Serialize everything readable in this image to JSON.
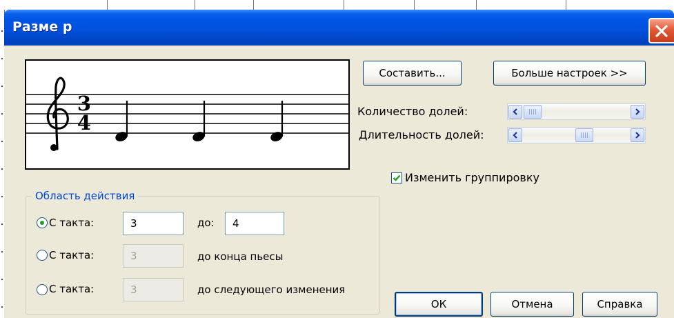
{
  "window": {
    "title": "Разме р"
  },
  "buttons": {
    "compose": "Составить...",
    "more_settings": "Больше настроек >>",
    "ok": "ОК",
    "cancel": "Отмена",
    "help": "Справка"
  },
  "beats": {
    "count_label": "Количество долей:",
    "count_value_fraction": 0.1,
    "duration_label": "Длительность долей:",
    "duration_value_fraction": 0.6
  },
  "regroup": {
    "label": "Изменить группировку",
    "checked": true
  },
  "scope": {
    "legend": "Область действия",
    "options": [
      {
        "label": "С такта:",
        "from": "3",
        "to_label": "до:",
        "to": "4",
        "selected": true,
        "enabled": true
      },
      {
        "label": "С такта:",
        "from": "3",
        "to_label": "до конца пьесы",
        "selected": false,
        "enabled": false
      },
      {
        "label": "С такта:",
        "from": "3",
        "to_label": "до следующего изменения",
        "selected": false,
        "enabled": false
      }
    ]
  },
  "preview": {
    "clef": "treble-clef",
    "time_signature": {
      "numerator": "3",
      "denominator": "4"
    },
    "notes_count": 3
  },
  "colors": {
    "titlebar": "#0054e3",
    "dialog_bg": "#ece9d8",
    "group_legend": "#0046d5",
    "check": "#21a121",
    "close_button": "#e35a36"
  },
  "icons": [
    "close-icon",
    "arrow-left-icon",
    "arrow-right-icon",
    "check-icon",
    "treble-clef-icon"
  ]
}
